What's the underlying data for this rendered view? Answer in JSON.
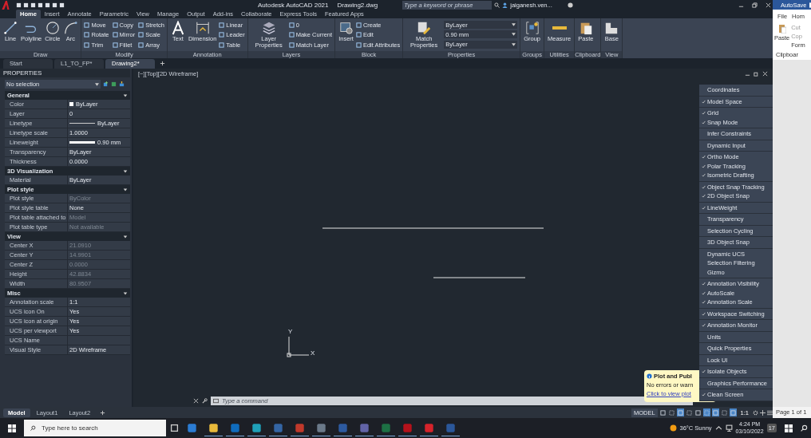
{
  "title_bar": {
    "title": "Autodesk AutoCAD 2021",
    "document": "Drawing2.dwg",
    "search": {
      "placeholder": "Type a keyword or phrase"
    },
    "user": "jaiganesh.ven..."
  },
  "ribbon_tabs": [
    {
      "label": "Home",
      "selected": true
    },
    {
      "label": "Insert",
      "selected": false
    },
    {
      "label": "Annotate",
      "selected": false
    },
    {
      "label": "Parametric",
      "selected": false
    },
    {
      "label": "View",
      "selected": false
    },
    {
      "label": "Manage",
      "selected": false
    },
    {
      "label": "Output",
      "selected": false
    },
    {
      "label": "Add-ins",
      "selected": false
    },
    {
      "label": "Collaborate",
      "selected": false
    },
    {
      "label": "Express Tools",
      "selected": false
    },
    {
      "label": "Featured Apps",
      "selected": false
    }
  ],
  "ribbon_panels": [
    {
      "title": "Draw",
      "large": [
        "Line",
        "Polyline",
        "Circle",
        "Arc"
      ]
    },
    {
      "title": "Modify",
      "small": [
        "Move",
        "Rotate",
        "Trim",
        "Copy",
        "Mirror",
        "Fillet",
        "Stretch",
        "Scale",
        "Array"
      ]
    },
    {
      "title": "Annotation",
      "large": [
        "Text",
        "Dimension"
      ],
      "small": [
        "Linear",
        "Leader",
        "Table"
      ]
    },
    {
      "title": "Layers",
      "large": [
        "Layer Properties"
      ],
      "small": [
        "0",
        "Make Current",
        "Match Layer"
      ]
    },
    {
      "title": "Block",
      "large": [
        "Insert"
      ],
      "small": [
        "Create",
        "Edit",
        "Edit Attributes"
      ]
    },
    {
      "title": "Properties",
      "large": [
        "Match Properties"
      ],
      "small": [
        "ByLayer",
        "0.90 mm",
        "ByLayer"
      ]
    },
    {
      "title": "Groups",
      "large": [
        "Group"
      ]
    },
    {
      "title": "Utilities",
      "large": [
        "Measure"
      ]
    },
    {
      "title": "Clipboard",
      "large": [
        "Paste"
      ]
    },
    {
      "title": "View",
      "large": [
        "Base"
      ]
    }
  ],
  "document_tabs": [
    {
      "label": "Start",
      "selected": false
    },
    {
      "label": "L1_TO_FP*",
      "selected": false
    },
    {
      "label": "Drawing2*",
      "selected": true
    }
  ],
  "properties": {
    "title": "PROPERTIES",
    "selection": "No selection",
    "sections": [
      {
        "title": "General",
        "expanded": true,
        "rows": [
          {
            "name": "Color",
            "value": "ByLayer",
            "kind": "swatch",
            "disabled": false
          },
          {
            "name": "Layer",
            "value": "0",
            "kind": "text",
            "disabled": false
          },
          {
            "name": "Linetype",
            "value": "ByLayer",
            "kind": "line",
            "disabled": false
          },
          {
            "name": "Linetype scale",
            "value": "1.0000",
            "kind": "text",
            "disabled": false
          },
          {
            "name": "Lineweight",
            "value": "0.90 mm",
            "kind": "bar",
            "disabled": false
          },
          {
            "name": "Transparency",
            "value": "ByLayer",
            "kind": "text",
            "disabled": false
          },
          {
            "name": "Thickness",
            "value": "0.0000",
            "kind": "text",
            "disabled": false
          }
        ]
      },
      {
        "title": "3D Visualization",
        "expanded": true,
        "rows": [
          {
            "name": "Material",
            "value": "ByLayer",
            "kind": "text",
            "disabled": false
          }
        ]
      },
      {
        "title": "Plot style",
        "expanded": true,
        "rows": [
          {
            "name": "Plot style",
            "value": "ByColor",
            "kind": "text",
            "disabled": true
          },
          {
            "name": "Plot style table",
            "value": "None",
            "kind": "text",
            "disabled": false
          },
          {
            "name": "Plot table attached to",
            "value": "Model",
            "kind": "text",
            "disabled": true
          },
          {
            "name": "Plot table type",
            "value": "Not available",
            "kind": "text",
            "disabled": true
          }
        ]
      },
      {
        "title": "View",
        "expanded": true,
        "rows": [
          {
            "name": "Center X",
            "value": "21.0910",
            "kind": "text",
            "disabled": true
          },
          {
            "name": "Center Y",
            "value": "14.9901",
            "kind": "text",
            "disabled": true
          },
          {
            "name": "Center Z",
            "value": "0.0000",
            "kind": "text",
            "disabled": true
          },
          {
            "name": "Height",
            "value": "42.8834",
            "kind": "text",
            "disabled": true
          },
          {
            "name": "Width",
            "value": "80.9507",
            "kind": "text",
            "disabled": true
          }
        ]
      },
      {
        "title": "Misc",
        "expanded": true,
        "rows": [
          {
            "name": "Annotation scale",
            "value": "1:1",
            "kind": "text",
            "disabled": false
          },
          {
            "name": "UCS icon On",
            "value": "Yes",
            "kind": "text",
            "disabled": false
          },
          {
            "name": "UCS icon at origin",
            "value": "Yes",
            "kind": "text",
            "disabled": false
          },
          {
            "name": "UCS per viewport",
            "value": "Yes",
            "kind": "text",
            "disabled": false
          },
          {
            "name": "UCS Name",
            "kind": "text"
          },
          {
            "name": "Visual Style",
            "value": "2D Wireframe",
            "kind": "text",
            "disabled": false
          }
        ]
      }
    ]
  },
  "viewport": {
    "label": "[−][Top][2D Wireframe]",
    "ucs_x": "X",
    "ucs_y": "Y"
  },
  "customization_menu": {
    "groups": [
      {
        "items": [
          {
            "label": "Coordinates",
            "checked": false
          }
        ]
      },
      {
        "items": [
          {
            "label": "Model Space",
            "checked": true
          }
        ]
      },
      {
        "items": [
          {
            "label": "Grid",
            "checked": true
          },
          {
            "label": "Snap Mode",
            "checked": true
          }
        ]
      },
      {
        "items": [
          {
            "label": "Infer Constraints",
            "checked": false
          }
        ]
      },
      {
        "items": [
          {
            "label": "Dynamic Input",
            "checked": false
          }
        ]
      },
      {
        "items": [
          {
            "label": "Ortho Mode",
            "checked": true
          },
          {
            "label": "Polar Tracking",
            "checked": true
          },
          {
            "label": "Isometric Drafting",
            "checked": true
          }
        ]
      },
      {
        "items": [
          {
            "label": "Object Snap Tracking",
            "checked": true
          },
          {
            "label": "2D Object Snap",
            "checked": true
          }
        ]
      },
      {
        "items": [
          {
            "label": "LineWeight",
            "checked": true
          }
        ]
      },
      {
        "items": [
          {
            "label": "Transparency",
            "checked": false
          }
        ]
      },
      {
        "items": [
          {
            "label": "Selection Cycling",
            "checked": false
          }
        ]
      },
      {
        "items": [
          {
            "label": "3D Object Snap",
            "checked": false
          }
        ]
      },
      {
        "items": [
          {
            "label": "Dynamic UCS",
            "checked": false
          },
          {
            "label": "Selection Filtering",
            "checked": false
          },
          {
            "label": "Gizmo",
            "checked": false
          }
        ]
      },
      {
        "items": [
          {
            "label": "Annotation Visibility",
            "checked": true
          },
          {
            "label": "AutoScale",
            "checked": true
          },
          {
            "label": "Annotation Scale",
            "checked": true
          }
        ]
      },
      {
        "items": [
          {
            "label": "Workspace Switching",
            "checked": true
          }
        ]
      },
      {
        "items": [
          {
            "label": "Annotation Monitor",
            "checked": true
          }
        ]
      },
      {
        "items": [
          {
            "label": "Units",
            "checked": false
          }
        ]
      },
      {
        "items": [
          {
            "label": "Quick Properties",
            "checked": false
          }
        ]
      },
      {
        "items": [
          {
            "label": "Lock UI",
            "checked": false
          }
        ]
      },
      {
        "items": [
          {
            "label": "Isolate Objects",
            "checked": true
          }
        ]
      },
      {
        "items": [
          {
            "label": "Graphics Performance",
            "checked": false
          }
        ]
      },
      {
        "items": [
          {
            "label": "Clean Screen",
            "checked": true
          }
        ]
      }
    ]
  },
  "notification": {
    "title": "Plot and Publ",
    "message": "No errors or warn",
    "link": "Click to view plot"
  },
  "command_line": {
    "placeholder": "Type a command"
  },
  "layout_tabs": [
    {
      "label": "Model",
      "selected": true
    },
    {
      "label": "Layout1",
      "selected": false
    },
    {
      "label": "Layout2",
      "selected": false
    }
  ],
  "status_bar": {
    "mode": "MODEL",
    "scale": "1:1",
    "toggles": [
      {
        "on": false
      },
      {
        "on": false
      },
      {
        "on": true
      },
      {
        "on": false
      },
      {
        "on": false
      },
      {
        "on": true
      },
      {
        "on": true
      },
      {
        "on": false
      },
      {
        "on": true
      }
    ]
  },
  "word_window": {
    "autosave": "AutoSave",
    "autosave_on": true,
    "tabs": [
      "File",
      "Hom"
    ],
    "paste": "Paste",
    "cut": "Cut",
    "copy": "Cop",
    "format": "Form",
    "group": "Clipboar",
    "page": "Page 1 of 1"
  },
  "taskbar": {
    "search": {
      "placeholder": "Type here to search"
    },
    "apps": [
      {
        "color": "#2b7cd3",
        "active": false
      },
      {
        "color": "#e8b93b",
        "active": true
      },
      {
        "color": "#0f6cbd",
        "active": true
      },
      {
        "color": "#1fa0b8",
        "active": true
      },
      {
        "color": "#3465a4",
        "active": true
      },
      {
        "color": "#c0392b",
        "active": true
      },
      {
        "color": "#6b7a8a",
        "active": true
      },
      {
        "color": "#2d5aa0",
        "active": true
      },
      {
        "color": "#6264a7",
        "active": true
      },
      {
        "color": "#1d7044",
        "active": true
      },
      {
        "color": "#b5121b",
        "active": true
      },
      {
        "color": "#d6232b",
        "active": true
      },
      {
        "color": "#2b579a",
        "active": true
      }
    ],
    "weather": "36°C  Sunny",
    "time": "4:24 PM",
    "date": "03/10/2022",
    "notifications": "17"
  }
}
